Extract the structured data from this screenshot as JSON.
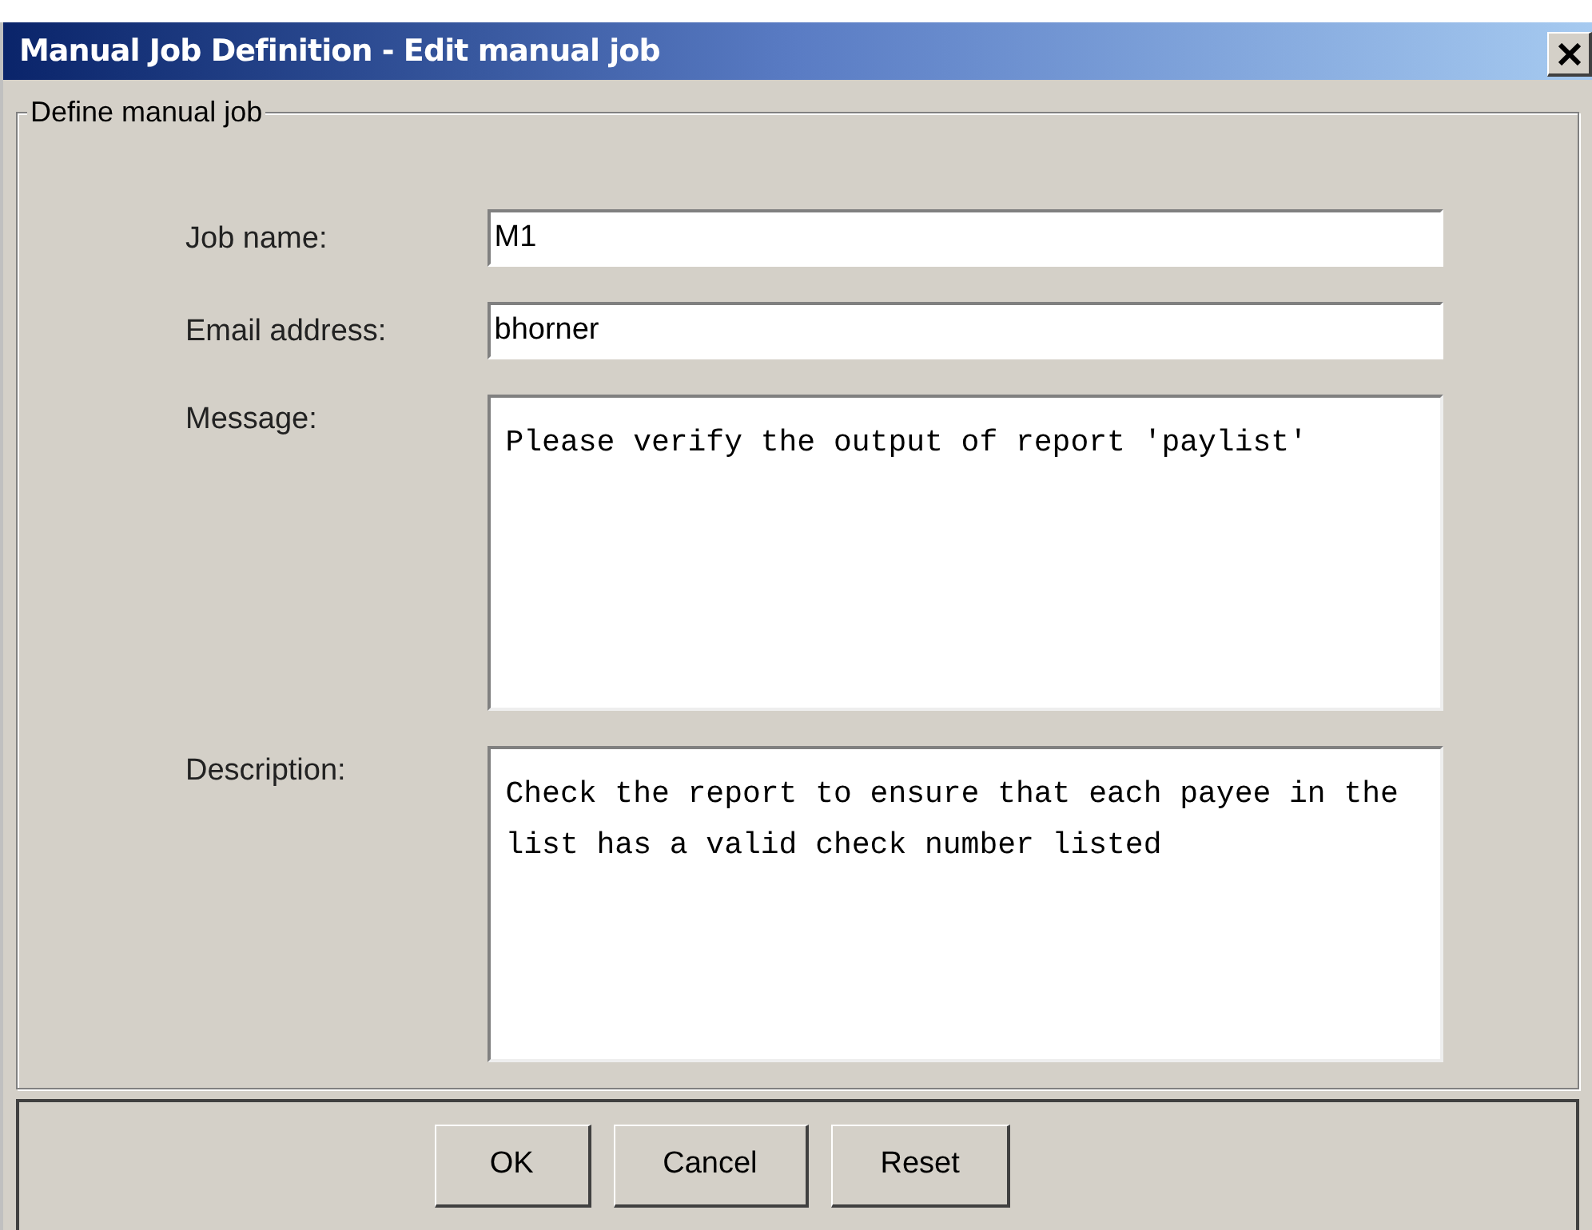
{
  "window": {
    "title": "Manual Job Definition - Edit manual job"
  },
  "group": {
    "title": "Define manual job"
  },
  "fields": [
    {
      "kind": "line",
      "label": "Job name:",
      "value": "M1"
    },
    {
      "kind": "line",
      "label": "Email address:",
      "value": "bhorner"
    },
    {
      "kind": "area",
      "label": "Message:",
      "value": "Please verify the output of report 'paylist'"
    },
    {
      "kind": "area",
      "label": "Description:",
      "value": "Check the report to ensure that each payee in the list has a valid check number listed"
    }
  ],
  "buttons": [
    "OK",
    "Cancel",
    "Reset"
  ]
}
